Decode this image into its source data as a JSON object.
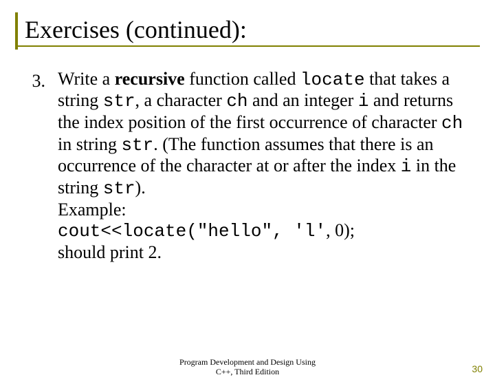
{
  "title": "Exercises (continued):",
  "item_number": "3.",
  "p": {
    "t1": "Write a ",
    "t2": "recursive",
    "t3": " function called ",
    "t4": "locate",
    "t5": " that takes a string ",
    "t6": "str",
    "t7": ", a character ",
    "t8": "ch",
    "t9": " and an integer ",
    "t10": "i",
    "t11": " and returns the index position of the first occurrence of character ",
    "t12": "ch",
    "t13": " in string ",
    "t14": "str",
    "t15": ". (The function assumes that there is an occurrence of the character at or after the index ",
    "t16": "i",
    "t17": " in the string ",
    "t18": "str",
    "t19": ").",
    "ex_label": "Example:",
    "code": "cout<<locate(\"hello\", 'l'",
    "code_tail": ", 0);",
    "result": "should print 2."
  },
  "footer": {
    "line1": "Program Development and Design Using",
    "line2": "C++, Third Edition"
  },
  "page_number": "30"
}
